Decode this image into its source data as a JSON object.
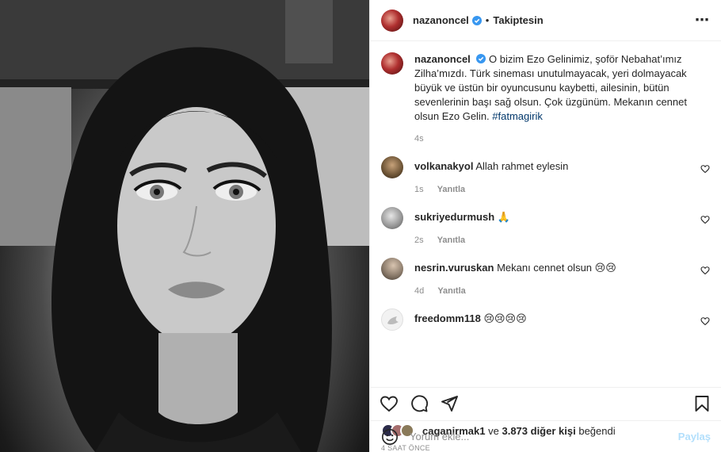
{
  "header": {
    "username": "nazanoncel",
    "separator": "•",
    "follow_status": "Takiptesin",
    "more_icon": "more-horizontal-icon"
  },
  "caption": {
    "username": "nazanoncel",
    "text": "O bizim Ezo Gelinimiz, şoför Nebahat’ımız Zilha’mızdı. Türk sineması unutulmayacak, yeri dolmayacak büyük ve üstün bir oyuncusunu kaybetti, ailesinin, bütün sevenlerinin başı sağ olsun. Çok üzgünüm. Mekanın cennet olsun Ezo Gelin.",
    "hashtag": "#fatmagirik",
    "age": "4s"
  },
  "comments": [
    {
      "username": "volkanakyol",
      "text": "Allah rahmet eylesin",
      "age": "1s",
      "reply": "Yanıtla",
      "avatar_color": "#6b5234"
    },
    {
      "username": "sukriyedurmush",
      "text": "🙏",
      "age": "2s",
      "reply": "Yanıtla",
      "avatar_color": "#9a9a9a"
    },
    {
      "username": "nesrin.vuruskan",
      "text": "Mekanı cennet olsun 😢😢",
      "age": "4d",
      "reply": "Yanıtla",
      "avatar_color": "#8a7a6a"
    },
    {
      "username": "freedomm118",
      "text": "😢😢😢😢",
      "avatar_color": "#d8d8d8"
    }
  ],
  "actions": {
    "like_icon": "heart-icon",
    "comment_icon": "comment-icon",
    "share_icon": "send-icon",
    "save_icon": "bookmark-icon"
  },
  "likes": {
    "first_user": "caganirmak1",
    "connector": "ve",
    "others": "3.873 diğer kişi",
    "suffix": "beğendi"
  },
  "timestamp": "4 SAAT ÖNCE",
  "add_comment": {
    "placeholder": "Yorum ekle...",
    "submit_label": "Paylaş",
    "emoji_icon": "smiley-icon"
  },
  "colors": {
    "verified": "#3897f0",
    "hashtag": "#00376b",
    "submit_disabled": "#b2dffc",
    "muted": "#8e8e8e"
  }
}
